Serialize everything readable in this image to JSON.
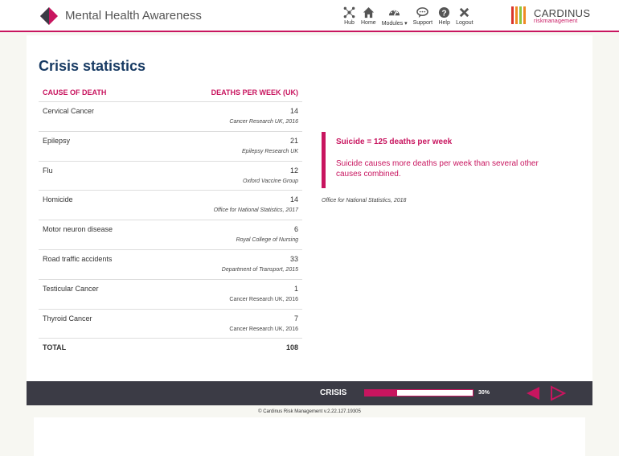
{
  "app": {
    "title": "Mental Health Awareness"
  },
  "nav": {
    "items": [
      {
        "label": "Hub",
        "icon": "hub-icon"
      },
      {
        "label": "Home",
        "icon": "home-icon"
      },
      {
        "label": "Modules ▾",
        "icon": "dashboard-icon"
      },
      {
        "label": "Support",
        "icon": "chat-icon"
      },
      {
        "label": "Help",
        "icon": "help-icon"
      },
      {
        "label": "Logout",
        "icon": "close-icon"
      }
    ]
  },
  "brand": {
    "name": "CARDINUS",
    "tagline": "riskmanagement",
    "bar_colors": [
      "#d9342b",
      "#f08a24",
      "#8cc63f",
      "#f08a24"
    ]
  },
  "page": {
    "title": "Crisis statistics"
  },
  "table": {
    "col_cause": "CAUSE OF DEATH",
    "col_deaths": "DEATHS PER WEEK (UK)",
    "rows": [
      {
        "cause": "Cervical Cancer",
        "deaths": "14",
        "source": "Cancer Research UK, 2016",
        "italic": true
      },
      {
        "cause": "Epilepsy",
        "deaths": "21",
        "source": "Epilepsy Research UK",
        "italic": true
      },
      {
        "cause": "Flu",
        "deaths": "12",
        "source": "Oxford Vaccine Group",
        "italic": true
      },
      {
        "cause": "Homicide",
        "deaths": "14",
        "source": "Office for National Statistics, 2017",
        "italic": true
      },
      {
        "cause": "Motor neuron disease",
        "deaths": "6",
        "source": "Royal College of Nursing",
        "italic": true
      },
      {
        "cause": "Road traffic accidents",
        "deaths": "33",
        "source": "Department of Transport, 2015",
        "italic": true
      },
      {
        "cause": "Testicular Cancer",
        "deaths": "1",
        "source": "Cancer Research UK, 2016",
        "italic": false
      },
      {
        "cause": "Thyroid Cancer",
        "deaths": "7",
        "source": "Cancer Research UK, 2016",
        "italic": false
      }
    ],
    "total_label": "TOTAL",
    "total_value": "108"
  },
  "callout": {
    "heading": "Suicide = 125 deaths per week",
    "body": "Suicide causes more deaths per week than several other causes combined.",
    "source": "Office for National Statistics, 2018"
  },
  "footer": {
    "section": "CRISIS",
    "progress_fraction": 0.3,
    "progress_label": "30%",
    "copyright": "© Cardinus Risk Management v.2.22.127.19305"
  },
  "colors": {
    "accent": "#c8155f",
    "title": "#173a63",
    "footer_bg": "#3b3b45"
  }
}
